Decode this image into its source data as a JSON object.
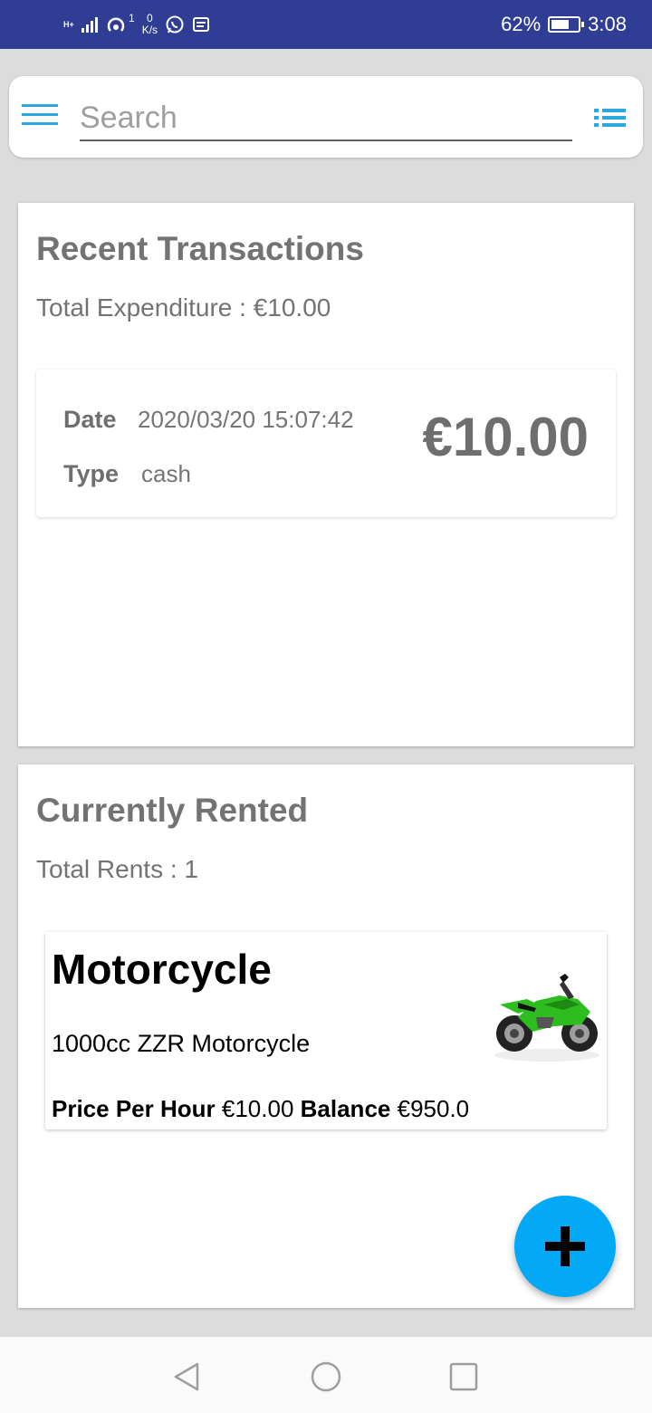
{
  "status_bar": {
    "network_type": "H+",
    "speed_value": "0",
    "speed_unit": "K/s",
    "hotspot_count": "1",
    "battery": "62%",
    "time": "3:08"
  },
  "search": {
    "placeholder": "Search",
    "value": ""
  },
  "recent_transactions": {
    "title": "Recent Transactions",
    "total_label": "Total Expenditure :",
    "total_value": "€10.00",
    "items": [
      {
        "date_label": "Date",
        "date_value": "2020/03/20 15:07:42",
        "type_label": "Type",
        "type_value": "cash",
        "amount": "€10.00"
      }
    ]
  },
  "currently_rented": {
    "title": "Currently Rented",
    "total_label": "Total Rents :",
    "total_value": "1",
    "items": [
      {
        "name": "Motorcycle",
        "description": "1000cc ZZR Motorcycle",
        "price_label": "Price Per Hour",
        "price_value": "€10.00",
        "balance_label": "Balance",
        "balance_value": "€950.0",
        "image_icon": "green-motorcycle-image"
      }
    ]
  },
  "colors": {
    "status_bar": "#2f3d94",
    "accent": "#2ba6df",
    "fab": "#03a9f4"
  }
}
